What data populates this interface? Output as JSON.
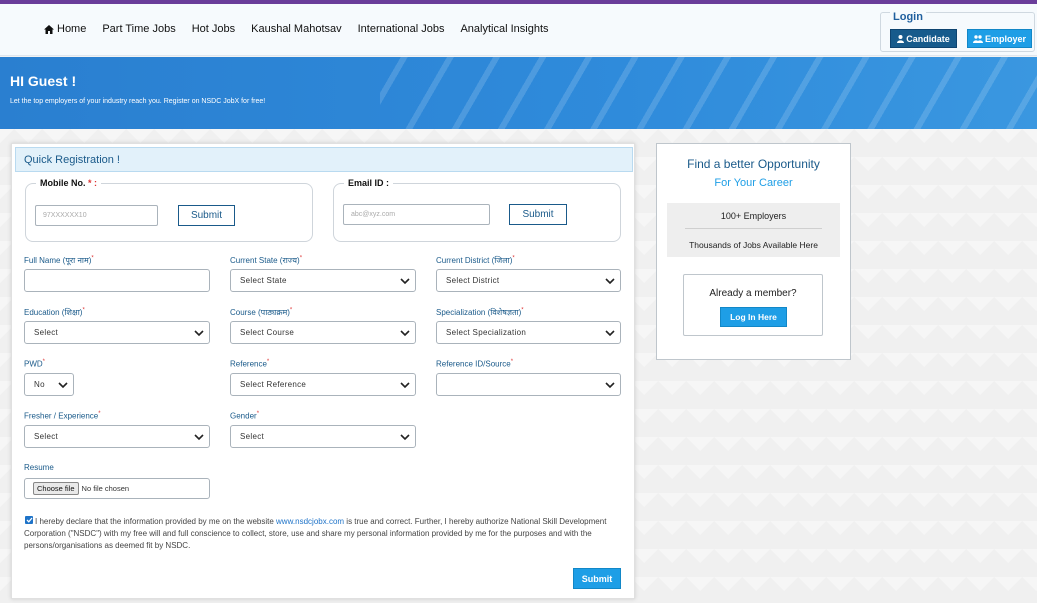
{
  "nav": {
    "items": [
      {
        "label": "Home",
        "icon": "home-icon"
      },
      {
        "label": "Part Time Jobs"
      },
      {
        "label": "Hot Jobs"
      },
      {
        "label": "Kaushal Mahotsav"
      },
      {
        "label": "International Jobs"
      },
      {
        "label": "Analytical Insights"
      }
    ]
  },
  "login": {
    "title": "Login",
    "candidate_label": "Candidate",
    "employer_label": "Employer"
  },
  "banner": {
    "title": "HI Guest !",
    "subtitle": "Let the top employers of your industry reach you. Register on NSDC JobX for free!"
  },
  "form": {
    "header": "Quick Registration !",
    "mobile": {
      "label": "Mobile No. ",
      "required": "* :",
      "placeholder": "97XXXXXX10",
      "submit": "Submit"
    },
    "email": {
      "label": "Email ID :",
      "placeholder": "abc@xyz.com",
      "submit": "Submit"
    },
    "fields": {
      "full_name": {
        "label": "Full Name (पूरा नाम)",
        "req": "*"
      },
      "current_state": {
        "label": "Current State (राज्य)",
        "req": "*",
        "value": "Select State"
      },
      "current_district": {
        "label": "Current District (जिला)",
        "req": "*",
        "value": "Select District"
      },
      "education": {
        "label": "Education (शिक्षा)",
        "req": "*",
        "value": "Select"
      },
      "course": {
        "label": "Course (पाठ्यक्रम)",
        "req": "*",
        "value": "Select Course"
      },
      "specialization": {
        "label": "Specialization (विशेषज्ञता)",
        "req": "*",
        "value": "Select Specialization"
      },
      "pwd": {
        "label": "PWD",
        "req": "*",
        "value": "No"
      },
      "reference": {
        "label": "Reference",
        "req": "*",
        "value": "Select Reference"
      },
      "reference_id": {
        "label": "Reference ID/Source",
        "req": "*",
        "value": ""
      },
      "fresher": {
        "label": "Fresher / Experience",
        "req": "*",
        "value": "Select"
      },
      "gender": {
        "label": "Gender",
        "req": "*",
        "value": "Select"
      },
      "resume": {
        "label": "Resume",
        "choose": "Choose file",
        "no_file": "No file chosen"
      }
    },
    "declaration": {
      "before": "I hereby declare that the information provided by me on the website ",
      "link": "www.nsdcjobx.com",
      "after": " is true and correct. Further, I hereby authorize National Skill Development Corporation (\"NSDC\") with my free will and full conscience to collect, store, use and share my personal information provided by me for the purposes and with the persons/organisations as deemed fit by NSDC."
    },
    "submit": "Submit"
  },
  "side": {
    "title1": "Find a better Opportunity",
    "title2": "For Your Career",
    "employers": "100+ Employers",
    "jobs": "Thousands of Jobs Available Here",
    "member_q": "Already a member?",
    "login_btn": "Log In Here"
  },
  "colors": {
    "accent": "#1e9ee6",
    "dark_blue": "#175b8c",
    "banner": "#2f8bdb",
    "top_strip": "#6a3d9a"
  }
}
